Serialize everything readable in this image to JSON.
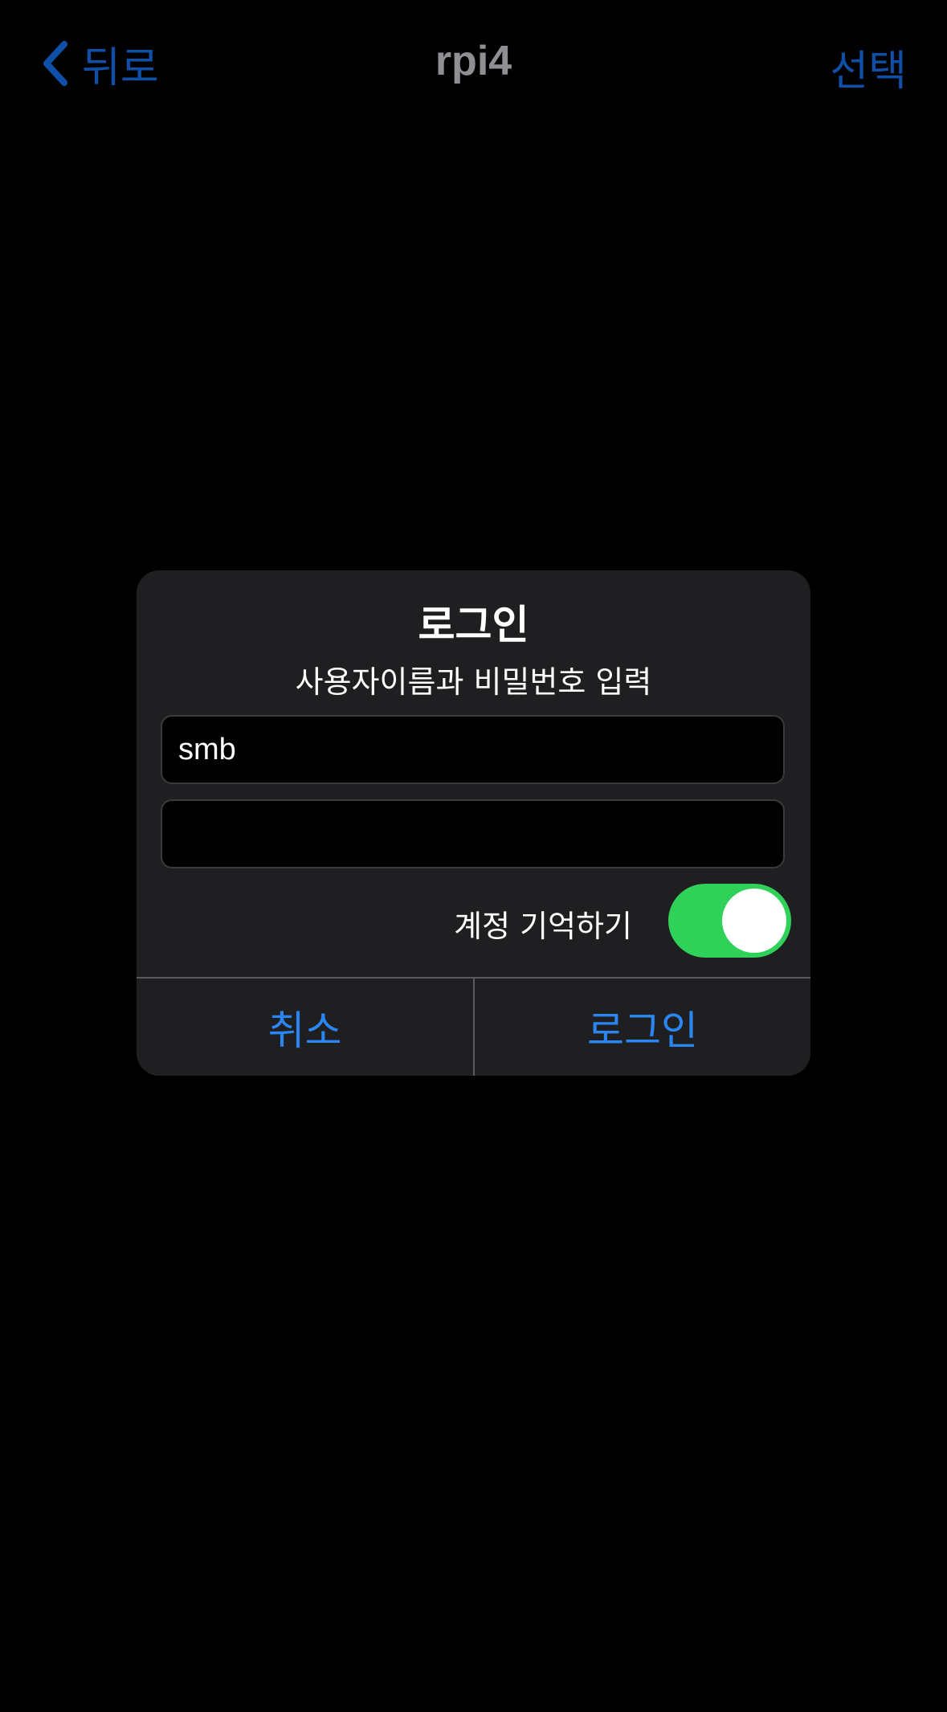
{
  "nav": {
    "back_label": "뒤로",
    "title": "rpi4",
    "select_label": "선택"
  },
  "dialog": {
    "title": "로그인",
    "message": "사용자이름과 비밀번호 입력",
    "username_value": "smb",
    "password_value": "",
    "remember_label": "계정 기억하기",
    "remember_on": true,
    "cancel_label": "취소",
    "login_label": "로그인"
  },
  "colors": {
    "background": "#000000",
    "dialog": "#1f1f21",
    "nav_accent": "#0f4fa8",
    "button_accent": "#2a86f2",
    "toggle_on": "#30d158",
    "title_gray": "#8e8e93"
  },
  "icons": {
    "back": "chevron-left-icon"
  }
}
